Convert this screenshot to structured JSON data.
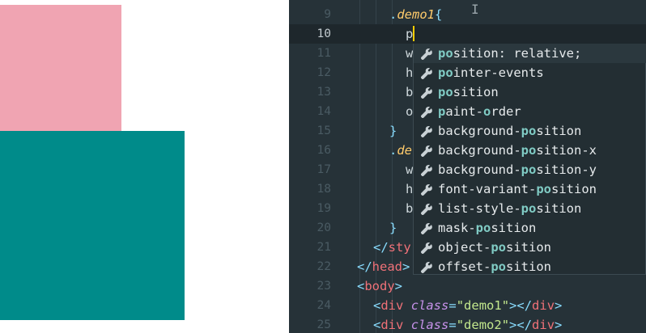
{
  "preview": {
    "box1_color": "#f0a4b2",
    "box2_color": "#008b8a"
  },
  "editor": {
    "lines": [
      {
        "num": "9",
        "code": ".demo1{"
      },
      {
        "num": "10",
        "code": "p"
      },
      {
        "num": "11",
        "code": "w"
      },
      {
        "num": "12",
        "code": "h"
      },
      {
        "num": "13",
        "code": "b"
      },
      {
        "num": "14",
        "code": "o"
      },
      {
        "num": "15",
        "code": "}"
      },
      {
        "num": "16",
        "code": ".de"
      },
      {
        "num": "17",
        "code": "w"
      },
      {
        "num": "18",
        "code": "h"
      },
      {
        "num": "19",
        "code": "b"
      },
      {
        "num": "20",
        "code": "}"
      },
      {
        "num": "21",
        "code": "</sty"
      },
      {
        "num": "22",
        "code": "</head>"
      },
      {
        "num": "23",
        "code": "<body>"
      },
      {
        "num": "24",
        "code": "<div class=\"demo1\"></div>"
      },
      {
        "num": "25",
        "code": "<div class=\"demo2\"></div>"
      }
    ],
    "active_line": "10",
    "typed_prefix": "p"
  },
  "suggest": {
    "icon": "wrench-icon",
    "items": [
      {
        "pre": "",
        "m1": "po",
        "mid": "sition: relative;",
        "m2": "",
        "post": ""
      },
      {
        "pre": "",
        "m1": "po",
        "mid": "inter-events",
        "m2": "",
        "post": ""
      },
      {
        "pre": "",
        "m1": "po",
        "mid": "sition",
        "m2": "",
        "post": ""
      },
      {
        "pre": "",
        "m1": "p",
        "mid": "aint-",
        "m2": "o",
        "post": "rder"
      },
      {
        "pre": "background-",
        "m1": "po",
        "mid": "sition",
        "m2": "",
        "post": ""
      },
      {
        "pre": "background-",
        "m1": "po",
        "mid": "sition-x",
        "m2": "",
        "post": ""
      },
      {
        "pre": "background-",
        "m1": "po",
        "mid": "sition-y",
        "m2": "",
        "post": ""
      },
      {
        "pre": "font-variant-",
        "m1": "po",
        "mid": "sition",
        "m2": "",
        "post": ""
      },
      {
        "pre": "list-style-",
        "m1": "po",
        "mid": "sition",
        "m2": "",
        "post": ""
      },
      {
        "pre": "mask-",
        "m1": "po",
        "mid": "sition",
        "m2": "",
        "post": ""
      },
      {
        "pre": "object-",
        "m1": "po",
        "mid": "sition",
        "m2": "",
        "post": ""
      },
      {
        "pre": "offset-",
        "m1": "po",
        "mid": "sition",
        "m2": "",
        "post": ""
      }
    ]
  }
}
